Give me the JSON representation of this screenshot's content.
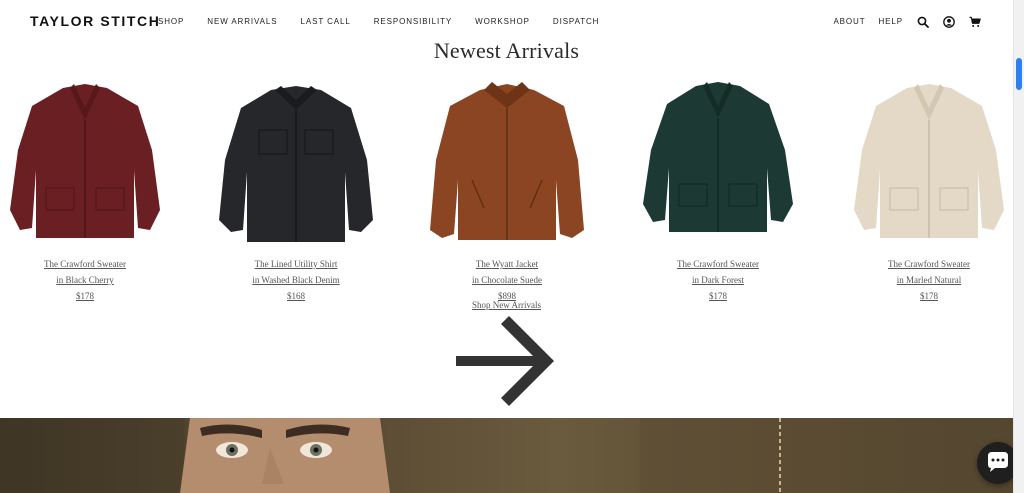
{
  "header": {
    "logo": "TAYLOR STITCH",
    "nav": [
      "SHOP",
      "NEW ARRIVALS",
      "LAST CALL",
      "RESPONSIBILITY",
      "WORKSHOP",
      "DISPATCH"
    ],
    "util": {
      "about": "ABOUT",
      "help": "HELP"
    },
    "icons": [
      "search-icon",
      "account-icon",
      "cart-icon"
    ]
  },
  "section": {
    "title": "Newest Arrivals",
    "products": [
      {
        "name": "The Crawford Sweater",
        "variant": "in Black Cherry",
        "price": "$178",
        "color": "#6a1f22"
      },
      {
        "name": "The Lined Utility Shirt",
        "variant": "in Washed Black Denim",
        "price": "$168",
        "color": "#26272a"
      },
      {
        "name": "The Wyatt Jacket",
        "variant": "in Chocolate Suede",
        "price": "$898",
        "color": "#8b4522"
      },
      {
        "name": "The Crawford Sweater",
        "variant": "in Dark Forest",
        "price": "$178",
        "color": "#1c3a33"
      },
      {
        "name": "The Crawford Sweater",
        "variant": "in Marled Natural",
        "price": "$178",
        "color": "#e3d9c6"
      }
    ],
    "shop_link": "Shop New Arrivals",
    "next_arrow_icon": "arrow-right-icon"
  },
  "chat": {
    "icon": "chat-bubble-icon"
  }
}
